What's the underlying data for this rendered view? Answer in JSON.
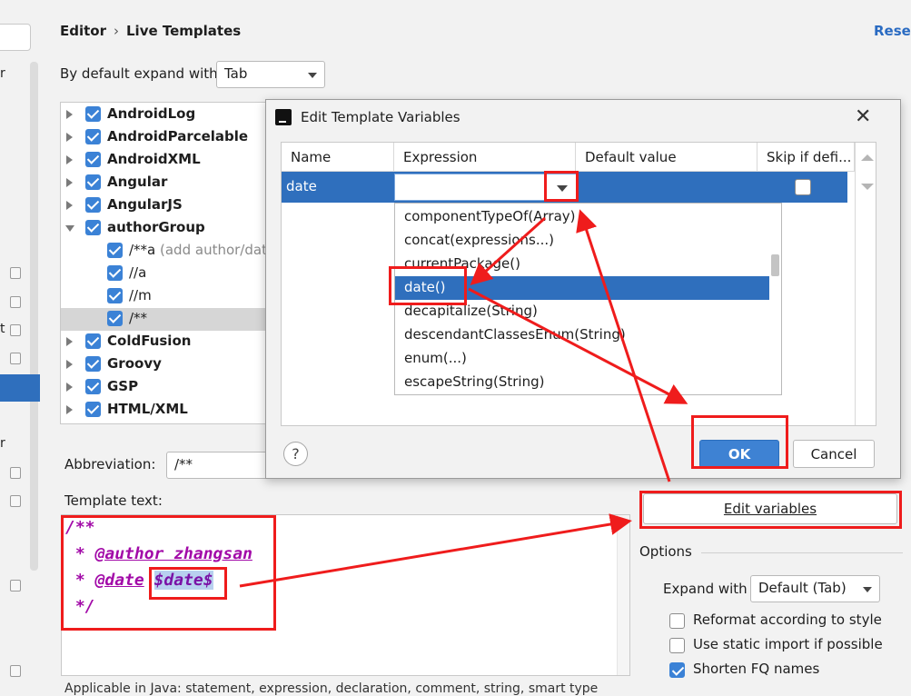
{
  "header": {
    "breadcrumb_parent": "Editor",
    "breadcrumb_current": "Live Templates",
    "reset_label": "Reset"
  },
  "expand": {
    "label": "By default expand with",
    "value": "Tab"
  },
  "sidebar": {
    "letters": [
      "r",
      "t",
      "r"
    ]
  },
  "tree": {
    "items": [
      {
        "label": "AndroidLog",
        "group": true
      },
      {
        "label": "AndroidParcelable",
        "group": true
      },
      {
        "label": "AndroidXML",
        "group": true
      },
      {
        "label": "Angular",
        "group": true
      },
      {
        "label": "AngularJS",
        "group": true
      },
      {
        "label": "authorGroup",
        "group": true,
        "expanded": true
      },
      {
        "label": "/**a",
        "desc": " (add author/date",
        "group": false
      },
      {
        "label": "//a",
        "group": false
      },
      {
        "label": "//m",
        "group": false
      },
      {
        "label": "/**",
        "group": false,
        "selected": true
      },
      {
        "label": "ColdFusion",
        "group": true
      },
      {
        "label": "Groovy",
        "group": true
      },
      {
        "label": "GSP",
        "group": true
      },
      {
        "label": "HTML/XML",
        "group": true
      }
    ]
  },
  "abbreviation": {
    "label": "Abbreviation:",
    "value": "/**"
  },
  "template_text": {
    "label": "Template text:",
    "lines": [
      "/**",
      " * ",
      "@author zhangsan",
      " * ",
      "@date",
      " ",
      "$date$",
      " */"
    ]
  },
  "hint": "Applicable in Java: statement, expression, declaration, comment, string, smart type",
  "edit_variables_label": "Edit variables",
  "options": {
    "label": "Options",
    "expand_with_label": "Expand with",
    "expand_with_value": "Default (Tab)",
    "items": [
      {
        "label": "Reformat according to style",
        "checked": false
      },
      {
        "label": "Use static import if possible",
        "checked": false
      },
      {
        "label": "Shorten FQ names",
        "checked": true
      }
    ]
  },
  "dialog": {
    "title": "Edit Template Variables",
    "close": "✕",
    "columns": [
      "Name",
      "Expression",
      "Default value",
      "Skip if defi..."
    ],
    "row": {
      "name": "date",
      "expression": "",
      "default_value": "",
      "skip": false
    },
    "expression_options": [
      "componentTypeOf(Array)",
      "concat(expressions...)",
      "currentPackage()",
      "date()",
      "decapitalize(String)",
      "descendantClassesEnum(String)",
      "enum(...)",
      "escapeString(String)"
    ],
    "selected_option": "date()",
    "help": "?",
    "ok": "OK",
    "cancel": "Cancel"
  },
  "colors": {
    "accent": "#2f6fbd",
    "annotation": "#ef1c1c",
    "template_text": "#a20aa8"
  }
}
